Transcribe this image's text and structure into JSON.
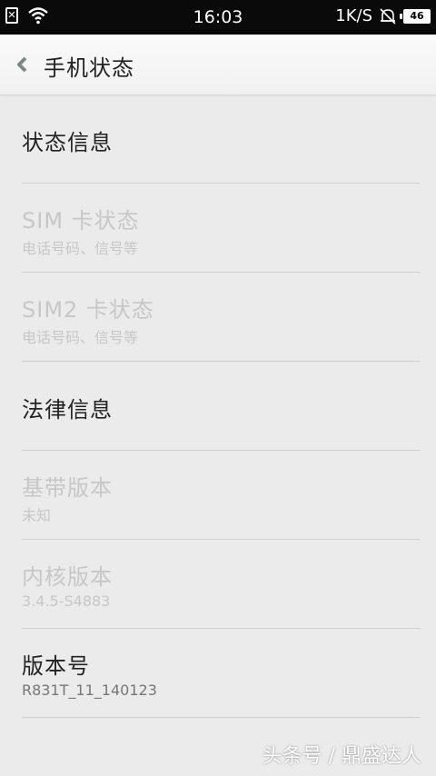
{
  "status_bar": {
    "time": "16:03",
    "speed": "1K/S",
    "battery": "46"
  },
  "header": {
    "title": "手机状态",
    "back_icon": "chevron-left-icon"
  },
  "items": [
    {
      "title": "状态信息",
      "subtitle": "",
      "enabled": true
    },
    {
      "title": "SIM 卡状态",
      "subtitle": "电话号码、信号等",
      "enabled": false
    },
    {
      "title": "SIM2 卡状态",
      "subtitle": "电话号码、信号等",
      "enabled": false
    },
    {
      "title": "法律信息",
      "subtitle": "",
      "enabled": true
    },
    {
      "title": "基带版本",
      "subtitle": "未知",
      "enabled": false
    },
    {
      "title": "内核版本",
      "subtitle": "3.4.5-S4883",
      "enabled": false
    },
    {
      "title": "版本号",
      "subtitle": "R831T_11_140123",
      "enabled": true
    }
  ],
  "watermark": "头条号 / 鼎盛达人",
  "colors": {
    "statusbar_bg": "#0a0a0a",
    "background": "#ebebeb",
    "text_primary": "#222222",
    "text_disabled": "#c7c7c7",
    "back_arrow": "#7a8a87"
  }
}
